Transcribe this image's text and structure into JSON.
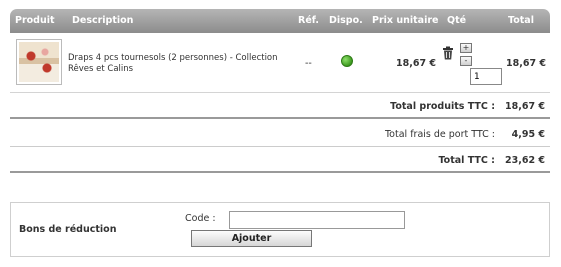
{
  "table": {
    "headers": {
      "produit": "Produit",
      "description": "Description",
      "ref": "Réf.",
      "dispo": "Dispo.",
      "prix_unitaire": "Prix unitaire",
      "qte": "Qté",
      "total": "Total"
    },
    "item": {
      "description": "Draps 4 pcs tournesols (2 personnes) - Collection Rêves et Calins",
      "ref": "--",
      "availability_color": "#4caf2a",
      "unit_price": "18,67 €",
      "plus_label": "+",
      "minus_label": "-",
      "quantity": "1",
      "total": "18,67 €"
    }
  },
  "summary": {
    "products_label": "Total produits TTC :",
    "products_value": "18,67 €",
    "shipping_label": "Total frais de port TTC :",
    "shipping_value": "4,95 €",
    "total_label": "Total TTC :",
    "total_value": "23,62 €"
  },
  "voucher": {
    "title": "Bons de réduction",
    "code_label": "Code :",
    "code_value": "",
    "button_label": "Ajouter"
  },
  "colors": {
    "header_bg": "#9f9f9f",
    "available": "#4caf2a"
  }
}
